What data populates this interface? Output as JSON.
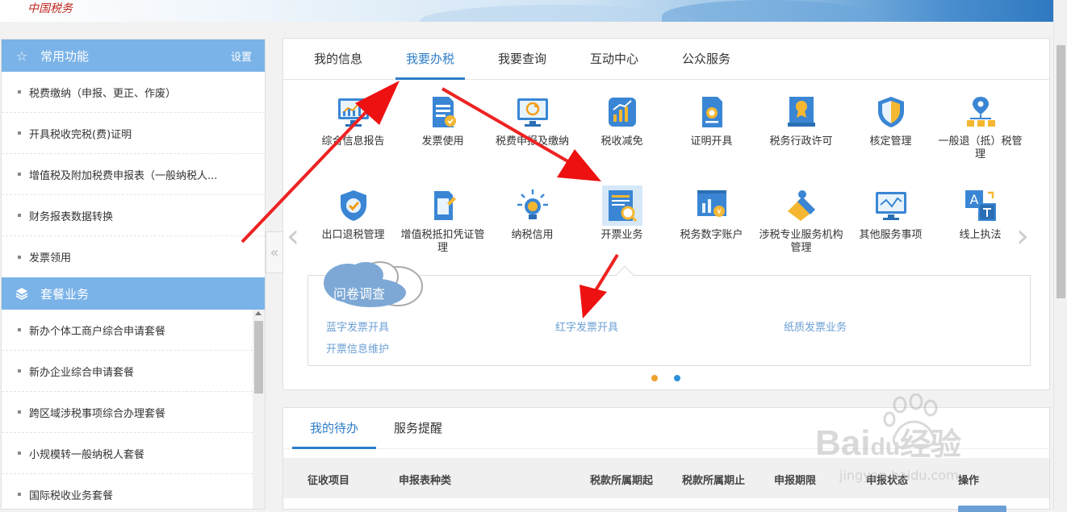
{
  "banner": {
    "logo_text": "中国税务"
  },
  "sidebar": {
    "common_title": "常用功能",
    "settings_label": "设置",
    "common_items": [
      {
        "label": "税费缴纳（申报、更正、作废）"
      },
      {
        "label": "开具税收完税(费)证明"
      },
      {
        "label": "增值税及附加税费申报表（一般纳税人..."
      },
      {
        "label": "财务报表数据转换"
      },
      {
        "label": "发票领用"
      }
    ],
    "package_title": "套餐业务",
    "package_items": [
      {
        "label": "新办个体工商户综合申请套餐"
      },
      {
        "label": "新办企业综合申请套餐"
      },
      {
        "label": "跨区域涉税事项综合办理套餐"
      },
      {
        "label": "小规模转一般纳税人套餐"
      },
      {
        "label": "国际税收业务套餐"
      }
    ],
    "collapse_glyph": "«"
  },
  "main": {
    "tabs": [
      {
        "label": "我的信息"
      },
      {
        "label": "我要办税",
        "active": true
      },
      {
        "label": "我要查询"
      },
      {
        "label": "互动中心"
      },
      {
        "label": "公众服务"
      }
    ],
    "functions_row1": [
      {
        "label": "综合信息报告",
        "icon": "chart-monitor-icon"
      },
      {
        "label": "发票使用",
        "icon": "invoice-document-icon"
      },
      {
        "label": "税费申报及缴纳",
        "icon": "monitor-refresh-icon"
      },
      {
        "label": "税收减免",
        "icon": "bar-chart-box-icon"
      },
      {
        "label": "证明开具",
        "icon": "certificate-doc-icon"
      },
      {
        "label": "税务行政许可",
        "icon": "license-badge-icon"
      },
      {
        "label": "核定管理",
        "icon": "shield-icon"
      },
      {
        "label": "一般退（抵）税管理",
        "icon": "location-tree-icon"
      }
    ],
    "functions_row2": [
      {
        "label": "出口退税管理",
        "icon": "shield-check-icon"
      },
      {
        "label": "增值税抵扣凭证管理",
        "icon": "receipt-edit-icon"
      },
      {
        "label": "纳税信用",
        "icon": "lightbulb-icon"
      },
      {
        "label": "开票业务",
        "icon": "invoice-search-icon",
        "active": true
      },
      {
        "label": "税务数字账户",
        "icon": "digital-account-icon"
      },
      {
        "label": "涉税专业服务机构管理",
        "icon": "tag-pin-icon"
      },
      {
        "label": "其他服务事项",
        "icon": "monitor-chart-icon"
      },
      {
        "label": "线上执法",
        "icon": "translate-icon"
      }
    ],
    "prev_glyph": "‹",
    "next_glyph": "›",
    "survey_label": "问卷调查",
    "sub_links": [
      {
        "label": "蓝字发票开具"
      },
      {
        "label": "红字发票开具"
      },
      {
        "label": "纸质发票业务"
      },
      {
        "label": "开票信息维护"
      }
    ],
    "pager_colors": [
      "#f0a030",
      "#2d8fd8"
    ]
  },
  "todo": {
    "tabs": [
      {
        "label": "我的待办",
        "active": true
      },
      {
        "label": "服务提醒"
      }
    ],
    "columns": [
      "征收项目",
      "申报表种类",
      "税款所属期起",
      "税款所属期止",
      "申报期限",
      "申报状态",
      "操作"
    ]
  },
  "watermark": {
    "brand": "Bai",
    "brand2": "du",
    "suffix": "经验",
    "url": "jingyan.baidu.com"
  }
}
